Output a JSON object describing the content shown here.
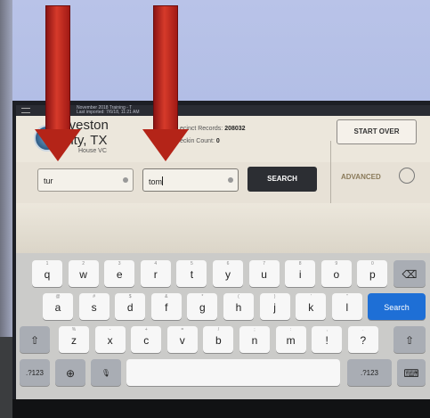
{
  "statusbar": {
    "line1": "November 2018 Training - T",
    "line2": "Last imported: 7/6/18, 11:21 AM"
  },
  "header": {
    "county_line1": "alveston",
    "county_line2": "unty, TX",
    "county_sub": "House VC",
    "precinct_label": "ecinct Records:",
    "precinct_value": "208032",
    "checkin_label": "eckin Count:",
    "checkin_value": "0",
    "start_over": "START OVER"
  },
  "search": {
    "last_name_value": "tur",
    "first_name_value": "tom",
    "search_button": "SEARCH",
    "advanced_label": "ADVANCED"
  },
  "keyboard": {
    "row1": [
      [
        "q",
        "1"
      ],
      [
        "w",
        "2"
      ],
      [
        "e",
        "3"
      ],
      [
        "r",
        "4"
      ],
      [
        "t",
        "5"
      ],
      [
        "y",
        "6"
      ],
      [
        "u",
        "7"
      ],
      [
        "i",
        "8"
      ],
      [
        "o",
        "9"
      ],
      [
        "p",
        "0"
      ]
    ],
    "row2": [
      [
        "a",
        "@"
      ],
      [
        "s",
        "#"
      ],
      [
        "d",
        "$"
      ],
      [
        "f",
        "&"
      ],
      [
        "g",
        "*"
      ],
      [
        "h",
        "("
      ],
      [
        "j",
        ")"
      ],
      [
        "k",
        "'"
      ],
      [
        "l",
        "\""
      ]
    ],
    "row3": [
      [
        "z",
        "%"
      ],
      [
        "x",
        "-"
      ],
      [
        "c",
        "+"
      ],
      [
        "v",
        "="
      ],
      [
        "b",
        "/"
      ],
      [
        "n",
        ";"
      ],
      [
        "m",
        ":"
      ],
      [
        "!",
        ","
      ],
      [
        "?",
        "."
      ]
    ],
    "search_key": "Search",
    "numbers_key_left": ".?123",
    "numbers_key_right": ".?123",
    "icons": {
      "delete": "backspace-icon",
      "shift": "shift-icon",
      "globe": "globe-icon",
      "mic": "microphone-icon",
      "hide": "keyboard-hide-icon"
    }
  },
  "colors": {
    "arrow_red": "#c0281c",
    "search_button_bg": "#2c2e33",
    "search_key_blue": "#1e6fd6"
  }
}
